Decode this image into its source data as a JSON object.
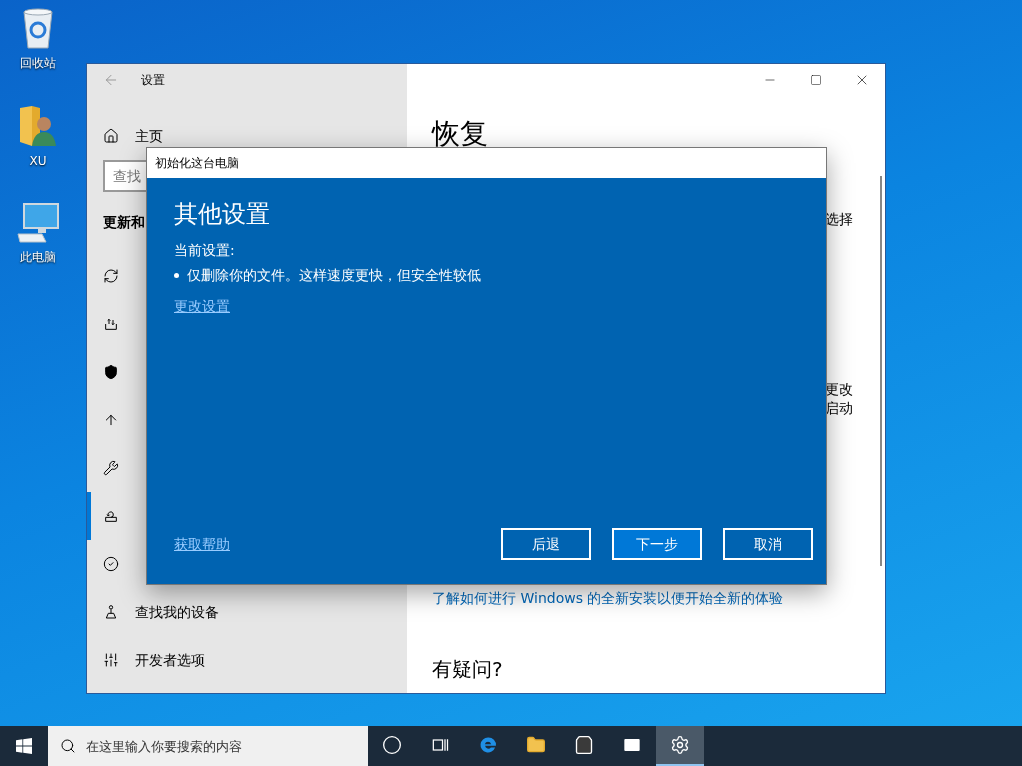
{
  "desktop_icons": [
    {
      "label": "回收站"
    },
    {
      "label": "XU"
    },
    {
      "label": "此电脑"
    }
  ],
  "settings_window": {
    "title": "设置",
    "sidebar": {
      "home": "主页",
      "search": {
        "placeholder": "查找"
      },
      "section": "更新和",
      "items": [
        {
          "selected": false
        },
        {
          "selected": false
        },
        {
          "selected": false
        },
        {
          "selected": false
        },
        {
          "selected": false
        },
        {
          "selected": true
        },
        {
          "selected": false
        },
        {
          "label": "查找我的设备",
          "selected": false
        },
        {
          "label": "开发者选项",
          "selected": false
        }
      ]
    },
    "content": {
      "title": "恢复",
      "side_texts": [
        "选择",
        "更改",
        "启动"
      ],
      "link": "了解如何进行 Windows 的全新安装以便开始全新的体验",
      "question": "有疑问?"
    }
  },
  "dialog": {
    "title": "初始化这台电脑",
    "heading": "其他设置",
    "current_label": "当前设置:",
    "bullets": [
      "仅删除你的文件。这样速度更快，但安全性较低"
    ],
    "change_link": "更改设置",
    "help_link": "获取帮助",
    "buttons": [
      {
        "label": "后退",
        "default": false
      },
      {
        "label": "下一步",
        "default": true
      },
      {
        "label": "取消",
        "default": false
      }
    ]
  },
  "taskbar": {
    "search": {
      "placeholder": "在这里输入你要搜索的内容"
    },
    "apps": [
      {
        "selected": false
      },
      {
        "selected": false
      },
      {
        "selected": false
      },
      {
        "selected": false
      },
      {
        "selected": false
      },
      {
        "selected": false
      },
      {
        "selected": true
      }
    ]
  }
}
